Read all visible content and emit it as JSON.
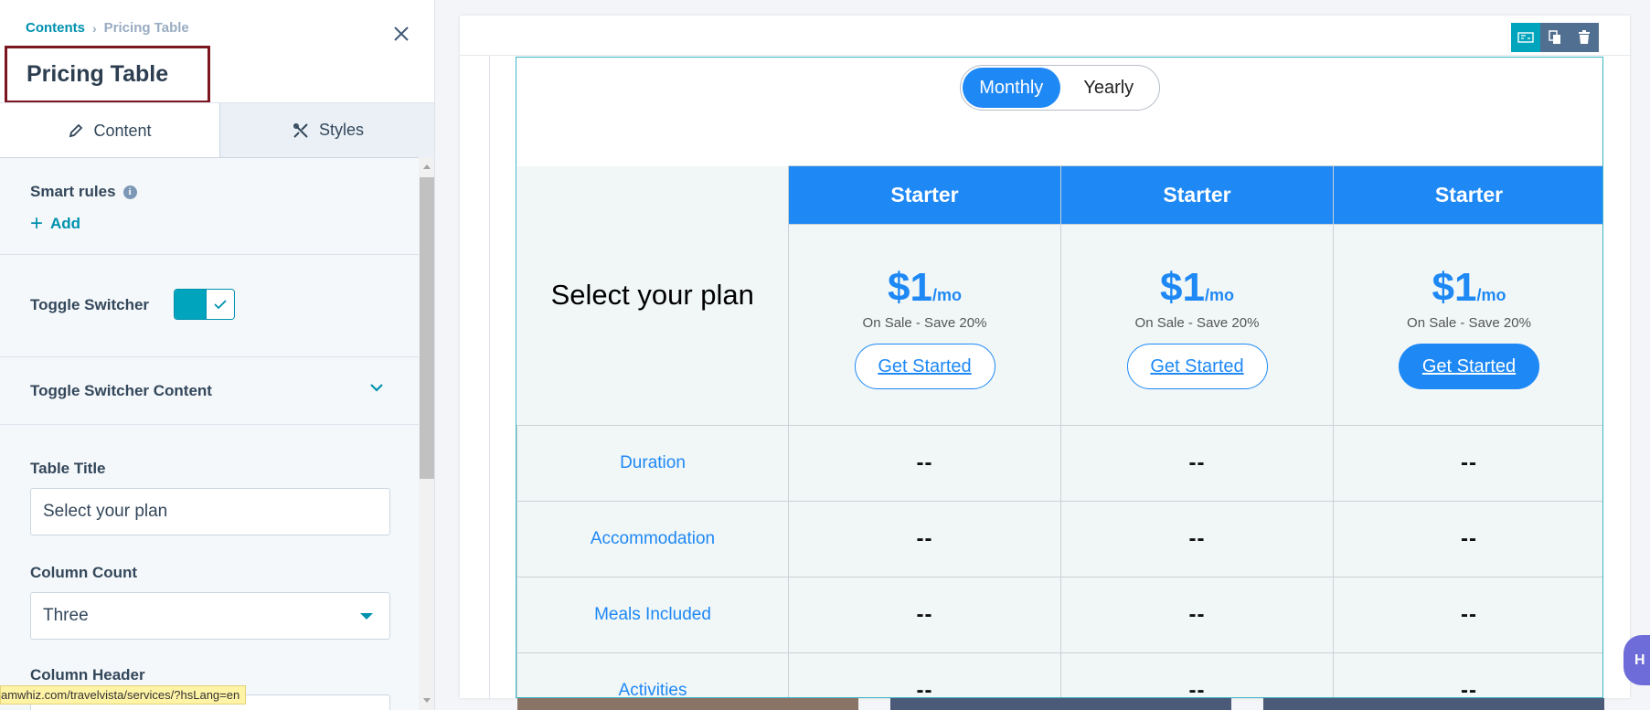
{
  "breadcrumb": {
    "parent": "Contents",
    "separator": "›",
    "current": "Pricing Table"
  },
  "panel": {
    "title": "Pricing Table"
  },
  "tabs": [
    {
      "label": "Content",
      "active": true
    },
    {
      "label": "Styles",
      "active": false
    }
  ],
  "smart_rules": {
    "label": "Smart rules",
    "add_label": "Add"
  },
  "toggle_switcher": {
    "label": "Toggle Switcher",
    "enabled": true
  },
  "toggle_switcher_content": {
    "label": "Toggle Switcher Content"
  },
  "table_title": {
    "label": "Table Title",
    "value": "Select your plan"
  },
  "column_count": {
    "label": "Column Count",
    "value": "Three"
  },
  "column_header": {
    "label": "Column Header"
  },
  "status_url": "amwhiz.com/travelvista/services/?hsLang=en",
  "colors": {
    "accent": "#1e88f5",
    "teal": "#00a4bd",
    "highlight_border": "#7b1520"
  },
  "preview": {
    "switch": {
      "monthly": "Monthly",
      "yearly": "Yearly",
      "selected": "Monthly"
    },
    "table_title": "Select your plan",
    "plans": [
      {
        "name": "Starter",
        "price": "$1",
        "period": "/mo",
        "sale": "On Sale - Save 20%",
        "cta": "Get Started",
        "cta_style": "outline"
      },
      {
        "name": "Starter",
        "price": "$1",
        "period": "/mo",
        "sale": "On Sale - Save 20%",
        "cta": "Get Started",
        "cta_style": "outline"
      },
      {
        "name": "Starter",
        "price": "$1",
        "period": "/mo",
        "sale": "On Sale - Save 20%",
        "cta": "Get Started",
        "cta_style": "filled"
      }
    ],
    "features": [
      {
        "name": "Duration",
        "values": [
          "--",
          "--",
          "--"
        ]
      },
      {
        "name": "Accommodation",
        "values": [
          "--",
          "--",
          "--"
        ]
      },
      {
        "name": "Meals Included",
        "values": [
          "--",
          "--",
          "--"
        ]
      },
      {
        "name": "Activities",
        "values": [
          "--",
          "--",
          "--"
        ]
      }
    ]
  },
  "side_tab": {
    "label": "H"
  }
}
